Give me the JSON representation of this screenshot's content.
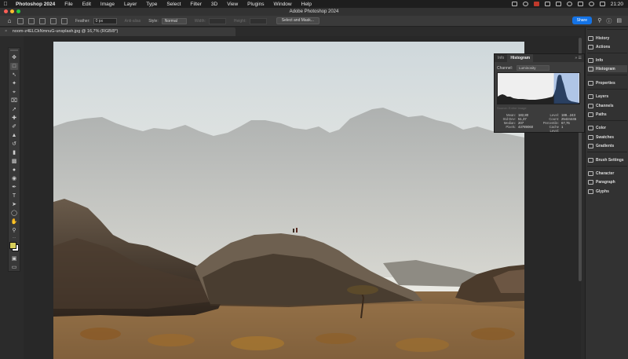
{
  "menubar": {
    "app_name": "Photoshop 2024",
    "items": [
      "File",
      "Edit",
      "Image",
      "Layer",
      "Type",
      "Select",
      "Filter",
      "3D",
      "View",
      "Plugins",
      "Window",
      "Help"
    ],
    "clock": "21:20"
  },
  "window": {
    "title": "Adobe Photoshop 2024"
  },
  "options_bar": {
    "feather_label": "Feather:",
    "feather_value": "0 px",
    "anti_alias_label": "Anti-alias",
    "style_label": "Style:",
    "style_value": "Normal",
    "width_label": "Width:",
    "height_label": "Height:",
    "select_mask_label": "Select and Mask...",
    "share_label": "Share"
  },
  "document": {
    "tab_title": "noom-z4ELCkNmnuG-unsplash.jpg @ 16,7% (RGB/8*)"
  },
  "toolbar": {
    "tools": [
      "move-tool",
      "marquee-tool",
      "lasso-tool",
      "quick-select-tool",
      "crop-tool",
      "frame-tool",
      "eyedropper-tool",
      "healing-tool",
      "brush-tool",
      "stamp-tool",
      "history-brush-tool",
      "eraser-tool",
      "gradient-tool",
      "blur-tool",
      "dodge-tool",
      "pen-tool",
      "type-tool",
      "path-select-tool",
      "shape-tool",
      "hand-tool",
      "zoom-tool"
    ],
    "foreground_color": "#d8cf5a",
    "background_color": "#ffffff"
  },
  "right_dock": {
    "groups": [
      [
        "History",
        "Actions"
      ],
      [
        "Info",
        "Histogram"
      ],
      [
        "Properties"
      ],
      [
        "Layers",
        "Channels",
        "Paths"
      ],
      [
        "Color",
        "Swatches",
        "Gradients"
      ],
      [
        "Brush Settings"
      ],
      [
        "Character",
        "Paragraph",
        "Glyphs"
      ]
    ]
  },
  "histogram_panel": {
    "tabs": [
      "Info",
      "Histogram"
    ],
    "active_tab": "Histogram",
    "channel_label": "Channel:",
    "channel_value": "Luminosity",
    "source_label": "Source:",
    "source_value": "Entire Image",
    "stats_left": [
      {
        "label": "Mean:",
        "value": "182,80"
      },
      {
        "label": "Std Dev:",
        "value": "51,37"
      },
      {
        "label": "Median:",
        "value": "207"
      },
      {
        "label": "Pixels:",
        "value": "43789060"
      }
    ],
    "stats_right": [
      {
        "label": "Level:",
        "value": "188...243"
      },
      {
        "label": "Count:",
        "value": "25424445"
      },
      {
        "label": "Percentile:",
        "value": "67,76"
      },
      {
        "label": "Cache Level:",
        "value": "1"
      }
    ]
  }
}
